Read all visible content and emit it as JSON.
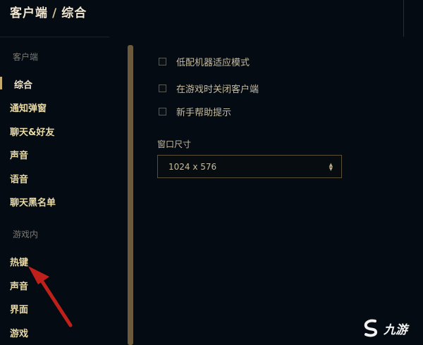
{
  "header": {
    "breadcrumb_parent": "客户端",
    "breadcrumb_separator": "/",
    "breadcrumb_current": "综合"
  },
  "sidebar": {
    "client_section": "客户端",
    "client_items": [
      "综合",
      "通知弹窗",
      "聊天&好友",
      "声音",
      "语音",
      "聊天黑名单"
    ],
    "ingame_section": "游戏内",
    "ingame_items": [
      "热键",
      "声音",
      "界面",
      "游戏"
    ],
    "active_item": "综合"
  },
  "content": {
    "checkboxes": [
      {
        "label": "低配机器适应模式",
        "checked": false
      },
      {
        "label": "在游戏时关闭客户端",
        "checked": false
      },
      {
        "label": "新手帮助提示",
        "checked": false
      }
    ],
    "window_size_label": "窗口尺寸",
    "window_size_value": "1024 x 576"
  },
  "watermark": {
    "text": "九游",
    "icon": "jiuyou-logo-icon"
  },
  "annotation": {
    "icon": "red-arrow-icon",
    "color": "#c0201a"
  },
  "colors": {
    "gold": "#c8aa6e",
    "background": "#050b12"
  }
}
